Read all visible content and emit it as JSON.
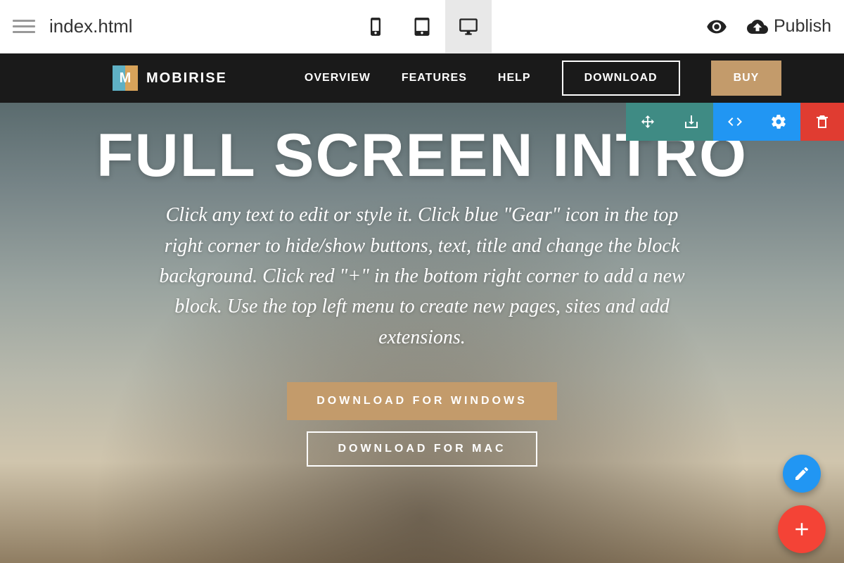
{
  "topbar": {
    "filename": "index.html",
    "publish_label": "Publish"
  },
  "site_nav": {
    "brand": "MOBIRISE",
    "links": [
      "OVERVIEW",
      "FEATURES",
      "HELP"
    ],
    "download_label": "DOWNLOAD",
    "buy_label": "BUY"
  },
  "hero": {
    "title": "FULL SCREEN INTRO",
    "subtitle": "Click any text to edit or style it. Click blue \"Gear\" icon in the top right corner to hide/show buttons, text, title and change the block background. Click red \"+\" in the bottom right corner to add a new block. Use the top left menu to create new pages, sites and add extensions.",
    "cta_primary": "DOWNLOAD FOR WINDOWS",
    "cta_secondary": "DOWNLOAD FOR MAC"
  }
}
